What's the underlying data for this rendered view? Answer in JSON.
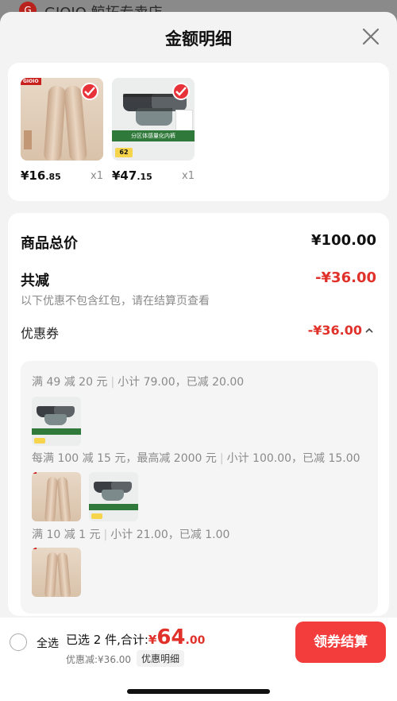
{
  "background": {
    "store_name": "GIOIO 鲸拓专卖店",
    "logo_text": "G"
  },
  "sheet": {
    "title": "金额明细"
  },
  "products": [
    {
      "brand_tag": "GIOIO",
      "side_tag": "",
      "price_main": "¥16",
      "price_decimal": ".85",
      "qty": "x1",
      "selected": true
    },
    {
      "price_main": "¥47",
      "price_decimal": ".15",
      "qty": "x1",
      "selected": true,
      "band_text": "分区体感量化内裤",
      "number_badge": "62"
    }
  ],
  "summary": {
    "total_label": "商品总价",
    "total_value": "¥100.00",
    "reduce_label": "共减",
    "reduce_value": "-¥36.00",
    "reduce_note": "以下优惠不包含红包，请在结算页查看",
    "coupon_label": "优惠券",
    "coupon_value": "-¥36.00"
  },
  "coupons": [
    {
      "rule": "满 49 减 20 元",
      "detail": "小计 79.00，已减 20.00"
    },
    {
      "rule": "每满 100 减 15 元，最高减 2000 元",
      "detail": "小计 100.00，已减 15.00"
    },
    {
      "rule": "满 10 减 1 元",
      "detail": "小计 21.00，已减 1.00"
    }
  ],
  "bottom_bar": {
    "select_all": "全选",
    "selected_prefix": "已选 2 件,合计:",
    "currency": "¥",
    "total_int": "64",
    "total_dec": ".00",
    "discount": "优惠减:¥36.00",
    "detail_chip": "优惠明细",
    "checkout": "领券结算"
  },
  "colors": {
    "accent_red": "#e0322a",
    "button_red": "#f33d3d",
    "check_red": "#e8323a"
  }
}
